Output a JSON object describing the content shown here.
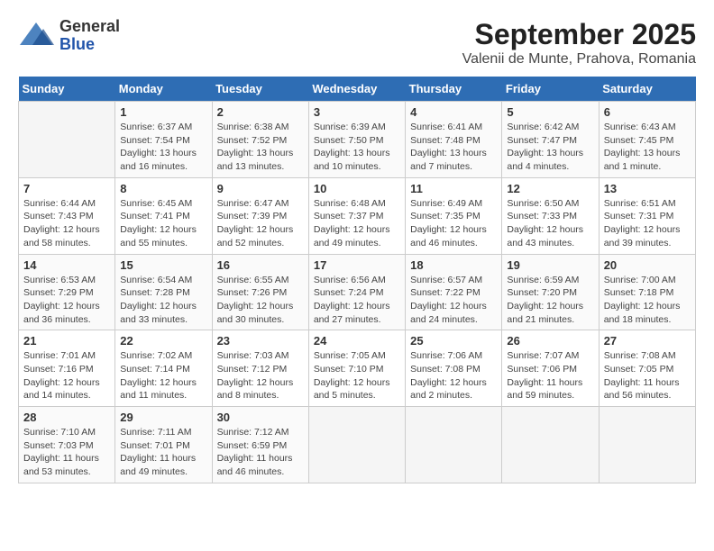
{
  "logo": {
    "general": "General",
    "blue": "Blue"
  },
  "title": "September 2025",
  "subtitle": "Valenii de Munte, Prahova, Romania",
  "headers": [
    "Sunday",
    "Monday",
    "Tuesday",
    "Wednesday",
    "Thursday",
    "Friday",
    "Saturday"
  ],
  "weeks": [
    [
      {
        "day": "",
        "info": ""
      },
      {
        "day": "1",
        "info": "Sunrise: 6:37 AM\nSunset: 7:54 PM\nDaylight: 13 hours and 16 minutes."
      },
      {
        "day": "2",
        "info": "Sunrise: 6:38 AM\nSunset: 7:52 PM\nDaylight: 13 hours and 13 minutes."
      },
      {
        "day": "3",
        "info": "Sunrise: 6:39 AM\nSunset: 7:50 PM\nDaylight: 13 hours and 10 minutes."
      },
      {
        "day": "4",
        "info": "Sunrise: 6:41 AM\nSunset: 7:48 PM\nDaylight: 13 hours and 7 minutes."
      },
      {
        "day": "5",
        "info": "Sunrise: 6:42 AM\nSunset: 7:47 PM\nDaylight: 13 hours and 4 minutes."
      },
      {
        "day": "6",
        "info": "Sunrise: 6:43 AM\nSunset: 7:45 PM\nDaylight: 13 hours and 1 minute."
      }
    ],
    [
      {
        "day": "7",
        "info": "Sunrise: 6:44 AM\nSunset: 7:43 PM\nDaylight: 12 hours and 58 minutes."
      },
      {
        "day": "8",
        "info": "Sunrise: 6:45 AM\nSunset: 7:41 PM\nDaylight: 12 hours and 55 minutes."
      },
      {
        "day": "9",
        "info": "Sunrise: 6:47 AM\nSunset: 7:39 PM\nDaylight: 12 hours and 52 minutes."
      },
      {
        "day": "10",
        "info": "Sunrise: 6:48 AM\nSunset: 7:37 PM\nDaylight: 12 hours and 49 minutes."
      },
      {
        "day": "11",
        "info": "Sunrise: 6:49 AM\nSunset: 7:35 PM\nDaylight: 12 hours and 46 minutes."
      },
      {
        "day": "12",
        "info": "Sunrise: 6:50 AM\nSunset: 7:33 PM\nDaylight: 12 hours and 43 minutes."
      },
      {
        "day": "13",
        "info": "Sunrise: 6:51 AM\nSunset: 7:31 PM\nDaylight: 12 hours and 39 minutes."
      }
    ],
    [
      {
        "day": "14",
        "info": "Sunrise: 6:53 AM\nSunset: 7:29 PM\nDaylight: 12 hours and 36 minutes."
      },
      {
        "day": "15",
        "info": "Sunrise: 6:54 AM\nSunset: 7:28 PM\nDaylight: 12 hours and 33 minutes."
      },
      {
        "day": "16",
        "info": "Sunrise: 6:55 AM\nSunset: 7:26 PM\nDaylight: 12 hours and 30 minutes."
      },
      {
        "day": "17",
        "info": "Sunrise: 6:56 AM\nSunset: 7:24 PM\nDaylight: 12 hours and 27 minutes."
      },
      {
        "day": "18",
        "info": "Sunrise: 6:57 AM\nSunset: 7:22 PM\nDaylight: 12 hours and 24 minutes."
      },
      {
        "day": "19",
        "info": "Sunrise: 6:59 AM\nSunset: 7:20 PM\nDaylight: 12 hours and 21 minutes."
      },
      {
        "day": "20",
        "info": "Sunrise: 7:00 AM\nSunset: 7:18 PM\nDaylight: 12 hours and 18 minutes."
      }
    ],
    [
      {
        "day": "21",
        "info": "Sunrise: 7:01 AM\nSunset: 7:16 PM\nDaylight: 12 hours and 14 minutes."
      },
      {
        "day": "22",
        "info": "Sunrise: 7:02 AM\nSunset: 7:14 PM\nDaylight: 12 hours and 11 minutes."
      },
      {
        "day": "23",
        "info": "Sunrise: 7:03 AM\nSunset: 7:12 PM\nDaylight: 12 hours and 8 minutes."
      },
      {
        "day": "24",
        "info": "Sunrise: 7:05 AM\nSunset: 7:10 PM\nDaylight: 12 hours and 5 minutes."
      },
      {
        "day": "25",
        "info": "Sunrise: 7:06 AM\nSunset: 7:08 PM\nDaylight: 12 hours and 2 minutes."
      },
      {
        "day": "26",
        "info": "Sunrise: 7:07 AM\nSunset: 7:06 PM\nDaylight: 11 hours and 59 minutes."
      },
      {
        "day": "27",
        "info": "Sunrise: 7:08 AM\nSunset: 7:05 PM\nDaylight: 11 hours and 56 minutes."
      }
    ],
    [
      {
        "day": "28",
        "info": "Sunrise: 7:10 AM\nSunset: 7:03 PM\nDaylight: 11 hours and 53 minutes."
      },
      {
        "day": "29",
        "info": "Sunrise: 7:11 AM\nSunset: 7:01 PM\nDaylight: 11 hours and 49 minutes."
      },
      {
        "day": "30",
        "info": "Sunrise: 7:12 AM\nSunset: 6:59 PM\nDaylight: 11 hours and 46 minutes."
      },
      {
        "day": "",
        "info": ""
      },
      {
        "day": "",
        "info": ""
      },
      {
        "day": "",
        "info": ""
      },
      {
        "day": "",
        "info": ""
      }
    ]
  ]
}
